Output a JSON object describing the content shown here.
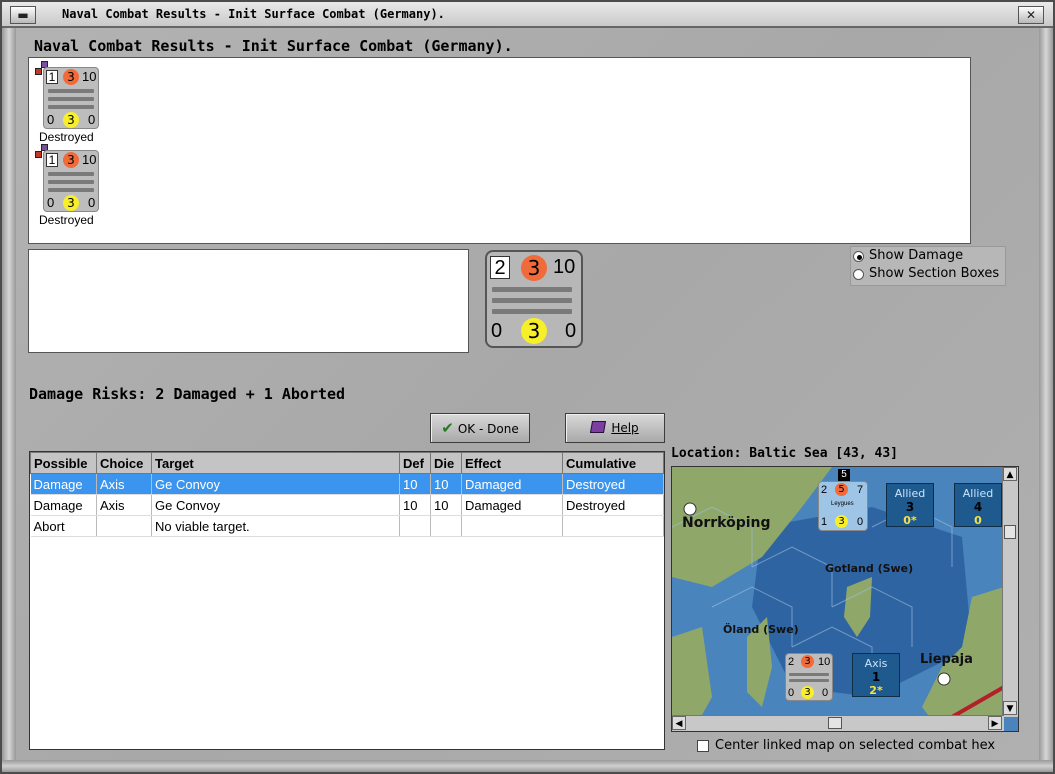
{
  "window": {
    "title": "Naval Combat Results - Init Surface Combat (Germany).",
    "minimize_glyph": "▬",
    "close_glyph": "✕"
  },
  "header": {
    "title": "Naval Combat Results - Init Surface Combat (Germany)."
  },
  "results": {
    "units": [
      {
        "top": "1",
        "attack": "3",
        "right": "10",
        "bl": "0",
        "bm": "3",
        "br": "0",
        "status": "Destroyed"
      },
      {
        "top": "1",
        "attack": "3",
        "right": "10",
        "bl": "0",
        "bm": "3",
        "br": "0",
        "status": "Destroyed"
      }
    ]
  },
  "selected_unit": {
    "top": "2",
    "attack": "3",
    "right": "10",
    "bl": "0",
    "bm": "3",
    "br": "0"
  },
  "display_options": {
    "show_damage": "Show Damage",
    "show_section_boxes": "Show Section Boxes",
    "selected": "show_damage"
  },
  "damage_risks": "Damage Risks: 2 Damaged + 1 Aborted",
  "buttons": {
    "ok": "OK - Done",
    "help": "Help"
  },
  "table": {
    "columns": [
      "Possible",
      "Choice",
      "Target",
      "Def",
      "Die",
      "Effect",
      "Cumulative"
    ],
    "rows": [
      {
        "possible": "Damage",
        "choice": "Axis",
        "target": "Ge Convoy",
        "def": "10",
        "die": "10",
        "effect": "Damaged",
        "cumulative": "Destroyed",
        "selected": true
      },
      {
        "possible": "Damage",
        "choice": "Axis",
        "target": "Ge Convoy",
        "def": "10",
        "die": "10",
        "effect": "Damaged",
        "cumulative": "Destroyed",
        "selected": false
      },
      {
        "possible": "Abort",
        "choice": "",
        "target": "No viable target.",
        "def": "",
        "die": "",
        "effect": "",
        "cumulative": "",
        "selected": false
      }
    ]
  },
  "map": {
    "location": "Location: Baltic Sea [43, 43]",
    "labels": {
      "norrkoping": "Norrköping",
      "gotland": "Gotland (Swe)",
      "oland": "Öland (Swe)",
      "liepaja": "Liepaja"
    },
    "stack_count": "5",
    "unit_top": {
      "a": "2",
      "b": "5",
      "c": "7",
      "d": "1",
      "e": "3",
      "f": "0",
      "name": "Leygues"
    },
    "unit_bottom": {
      "a": "2",
      "b": "3",
      "c": "10",
      "d": "0",
      "e": "3",
      "f": "0"
    },
    "boxes": [
      {
        "name": "Allied",
        "v1": "3",
        "v2": "0*"
      },
      {
        "name": "Allied",
        "v1": "4",
        "v2": "0"
      },
      {
        "name": "Axis",
        "v1": "1",
        "v2": "2*"
      }
    ],
    "colors": {
      "sea_deep": "#2f64a3",
      "sea": "#4a84bd",
      "land": "#8fa86a",
      "box": "#1e5a8e"
    }
  },
  "center_linked_map": "Center linked map on selected combat hex"
}
